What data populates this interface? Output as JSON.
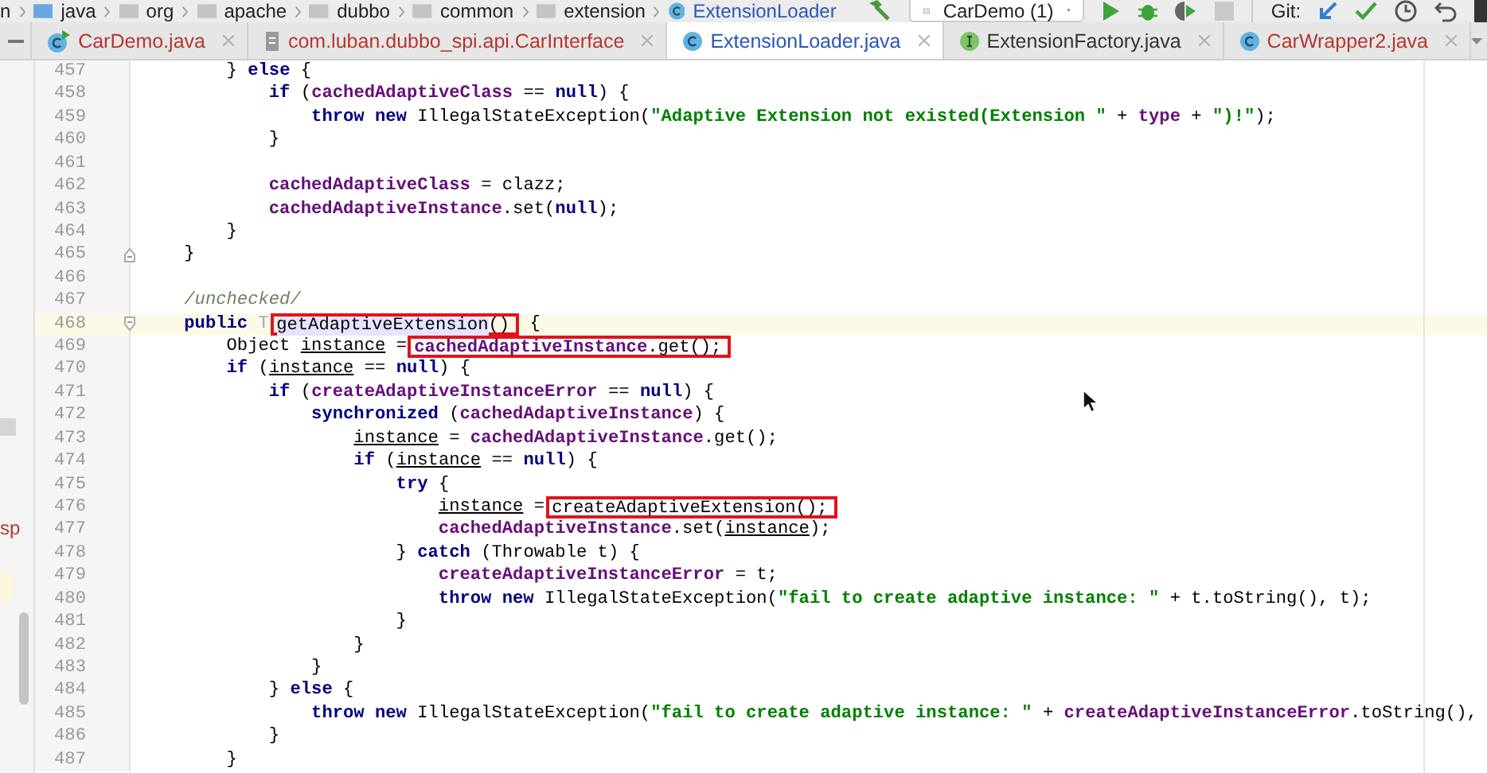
{
  "breadcrumbs": [
    {
      "text": "n",
      "kind": "plain"
    },
    {
      "text": "java",
      "kind": "source-folder"
    },
    {
      "text": "org",
      "kind": "package"
    },
    {
      "text": "apache",
      "kind": "package"
    },
    {
      "text": "dubbo",
      "kind": "package"
    },
    {
      "text": "common",
      "kind": "package"
    },
    {
      "text": "extension",
      "kind": "package"
    },
    {
      "text": "ExtensionLoader",
      "kind": "class"
    }
  ],
  "toolbar": {
    "run_config": "CarDemo (1)",
    "git_label": "Git:"
  },
  "tabs": [
    {
      "label": "CarDemo.java",
      "kind": "main-class",
      "selected": false,
      "color": "#b5372f"
    },
    {
      "label": "com.luban.dubbo_spi.api.CarInterface",
      "kind": "file",
      "selected": false,
      "color": "#b5372f"
    },
    {
      "label": "ExtensionLoader.java",
      "kind": "class",
      "selected": true,
      "color": "#2a56b5"
    },
    {
      "label": "ExtensionFactory.java",
      "kind": "interface",
      "selected": false,
      "color": "#333333"
    },
    {
      "label": "CarWrapper2.java",
      "kind": "class",
      "selected": false,
      "color": "#b5372f"
    }
  ],
  "left_panel": {
    "text": "sp"
  },
  "lines": [
    {
      "number": "457",
      "tokens": [
        {
          "kind": "plain",
          "text": "        } "
        },
        {
          "kind": "kw",
          "text": "else"
        },
        {
          "kind": "plain",
          "text": " {"
        }
      ]
    },
    {
      "number": "458",
      "tokens": [
        {
          "kind": "kw",
          "text": "            if"
        },
        {
          "kind": "plain",
          "text": " ("
        },
        {
          "kind": "field",
          "text": "cachedAdaptiveClass"
        },
        {
          "kind": "plain",
          "text": " == "
        },
        {
          "kind": "kw",
          "text": "null"
        },
        {
          "kind": "plain",
          "text": ") {"
        }
      ]
    },
    {
      "number": "459",
      "tokens": [
        {
          "kind": "kw",
          "text": "                throw new"
        },
        {
          "kind": "plain",
          "text": " IllegalStateException("
        },
        {
          "kind": "str",
          "text": "\"Adaptive Extension not existed(Extension \""
        },
        {
          "kind": "plain",
          "text": " + "
        },
        {
          "kind": "field",
          "text": "type"
        },
        {
          "kind": "plain",
          "text": " + "
        },
        {
          "kind": "str",
          "text": "\")!\""
        },
        {
          "kind": "plain",
          "text": ");"
        }
      ]
    },
    {
      "number": "460",
      "tokens": [
        {
          "kind": "plain",
          "text": "            }"
        }
      ]
    },
    {
      "number": "461"
    },
    {
      "number": "462",
      "tokens": [
        {
          "kind": "field",
          "text": "            cachedAdaptiveClass"
        },
        {
          "kind": "plain",
          "text": " = clazz;"
        }
      ]
    },
    {
      "number": "463",
      "tokens": [
        {
          "kind": "field",
          "text": "            cachedAdaptiveInstance"
        },
        {
          "kind": "plain",
          "text": ".set("
        },
        {
          "kind": "kw",
          "text": "null"
        },
        {
          "kind": "plain",
          "text": ");"
        }
      ]
    },
    {
      "number": "464",
      "tokens": [
        {
          "kind": "plain",
          "text": "        }"
        }
      ]
    },
    {
      "number": "465",
      "fold": {
        "kind": "end"
      },
      "tokens": [
        {
          "kind": "plain",
          "text": "    }"
        }
      ]
    },
    {
      "number": "466"
    },
    {
      "number": "467",
      "tokens": [
        {
          "kind": "comment",
          "text": "    /unchecked/"
        }
      ]
    },
    {
      "number": "468",
      "fold": {
        "kind": "start"
      },
      "current": true,
      "tokens": [
        {
          "kind": "kw",
          "text": "    public "
        },
        {
          "kind": "type",
          "text": "T "
        },
        {
          "kind": "hl",
          "text": "getAdaptiveExtension",
          "boxed": true
        },
        {
          "kind": "plain",
          "text": "()",
          "boxed": true
        },
        {
          "kind": "plain",
          "text": " {"
        }
      ]
    },
    {
      "number": "469",
      "tokens": [
        {
          "kind": "plain",
          "text": "        Object "
        },
        {
          "kind": "var",
          "text": "instance"
        },
        {
          "kind": "plain",
          "text": " = "
        },
        {
          "kind": "field",
          "text": "cachedAdaptiveInstance",
          "boxed": true
        },
        {
          "kind": "plain",
          "text": ".get();",
          "boxed": true
        }
      ]
    },
    {
      "number": "470",
      "tokens": [
        {
          "kind": "kw",
          "text": "        if"
        },
        {
          "kind": "plain",
          "text": " ("
        },
        {
          "kind": "var",
          "text": "instance"
        },
        {
          "kind": "plain",
          "text": " == "
        },
        {
          "kind": "kw",
          "text": "null"
        },
        {
          "kind": "plain",
          "text": ") {"
        }
      ]
    },
    {
      "number": "471",
      "tokens": [
        {
          "kind": "kw",
          "text": "            if"
        },
        {
          "kind": "plain",
          "text": " ("
        },
        {
          "kind": "field",
          "text": "createAdaptiveInstanceError"
        },
        {
          "kind": "plain",
          "text": " == "
        },
        {
          "kind": "kw",
          "text": "null"
        },
        {
          "kind": "plain",
          "text": ") {"
        }
      ]
    },
    {
      "number": "472",
      "tokens": [
        {
          "kind": "kw",
          "text": "                synchronized"
        },
        {
          "kind": "plain",
          "text": " ("
        },
        {
          "kind": "field",
          "text": "cachedAdaptiveInstance"
        },
        {
          "kind": "plain",
          "text": ") {"
        }
      ]
    },
    {
      "number": "473",
      "tokens": [
        {
          "kind": "var",
          "text": "                    instance"
        },
        {
          "kind": "plain",
          "text": " = "
        },
        {
          "kind": "field",
          "text": "cachedAdaptiveInstance"
        },
        {
          "kind": "plain",
          "text": ".get();"
        }
      ]
    },
    {
      "number": "474",
      "tokens": [
        {
          "kind": "kw",
          "text": "                    if"
        },
        {
          "kind": "plain",
          "text": " ("
        },
        {
          "kind": "var",
          "text": "instance"
        },
        {
          "kind": "plain",
          "text": " == "
        },
        {
          "kind": "kw",
          "text": "null"
        },
        {
          "kind": "plain",
          "text": ") {"
        }
      ]
    },
    {
      "number": "475",
      "tokens": [
        {
          "kind": "kw",
          "text": "                        try"
        },
        {
          "kind": "plain",
          "text": " {"
        }
      ]
    },
    {
      "number": "476",
      "tokens": [
        {
          "kind": "var",
          "text": "                            instance"
        },
        {
          "kind": "plain",
          "text": " = "
        },
        {
          "kind": "plain",
          "text": "createAdaptiveExtension();",
          "boxed": true
        }
      ]
    },
    {
      "number": "477",
      "tokens": [
        {
          "kind": "field",
          "text": "                            cachedAdaptiveInstance"
        },
        {
          "kind": "plain",
          "text": ".set("
        },
        {
          "kind": "var",
          "text": "instance"
        },
        {
          "kind": "plain",
          "text": ");"
        }
      ]
    },
    {
      "number": "478",
      "tokens": [
        {
          "kind": "plain",
          "text": "                        } "
        },
        {
          "kind": "kw",
          "text": "catch"
        },
        {
          "kind": "plain",
          "text": " (Throwable t) {"
        }
      ]
    },
    {
      "number": "479",
      "tokens": [
        {
          "kind": "field",
          "text": "                            createAdaptiveInstanceError"
        },
        {
          "kind": "plain",
          "text": " = t;"
        }
      ]
    },
    {
      "number": "480",
      "tokens": [
        {
          "kind": "kw",
          "text": "                            throw new"
        },
        {
          "kind": "plain",
          "text": " IllegalStateException("
        },
        {
          "kind": "str",
          "text": "\"fail to create adaptive instance: \""
        },
        {
          "kind": "plain",
          "text": " + t.toString(), t);"
        }
      ]
    },
    {
      "number": "481",
      "tokens": [
        {
          "kind": "plain",
          "text": "                        }"
        }
      ]
    },
    {
      "number": "482",
      "tokens": [
        {
          "kind": "plain",
          "text": "                    }"
        }
      ]
    },
    {
      "number": "483",
      "tokens": [
        {
          "kind": "plain",
          "text": "                }"
        }
      ]
    },
    {
      "number": "484",
      "tokens": [
        {
          "kind": "plain",
          "text": "            } "
        },
        {
          "kind": "kw",
          "text": "else"
        },
        {
          "kind": "plain",
          "text": " {"
        }
      ]
    },
    {
      "number": "485",
      "tokens": [
        {
          "kind": "kw",
          "text": "                throw new"
        },
        {
          "kind": "plain",
          "text": " IllegalStateException("
        },
        {
          "kind": "str",
          "text": "\"fail to create adaptive instance: \""
        },
        {
          "kind": "plain",
          "text": " + "
        },
        {
          "kind": "field",
          "text": "createAdaptiveInstanceError"
        },
        {
          "kind": "plain",
          "text": ".toString(),"
        }
      ]
    },
    {
      "number": "486",
      "tokens": [
        {
          "kind": "plain",
          "text": "            }"
        }
      ]
    },
    {
      "number": "487",
      "tokens": [
        {
          "kind": "plain",
          "text": "        }"
        }
      ]
    }
  ]
}
